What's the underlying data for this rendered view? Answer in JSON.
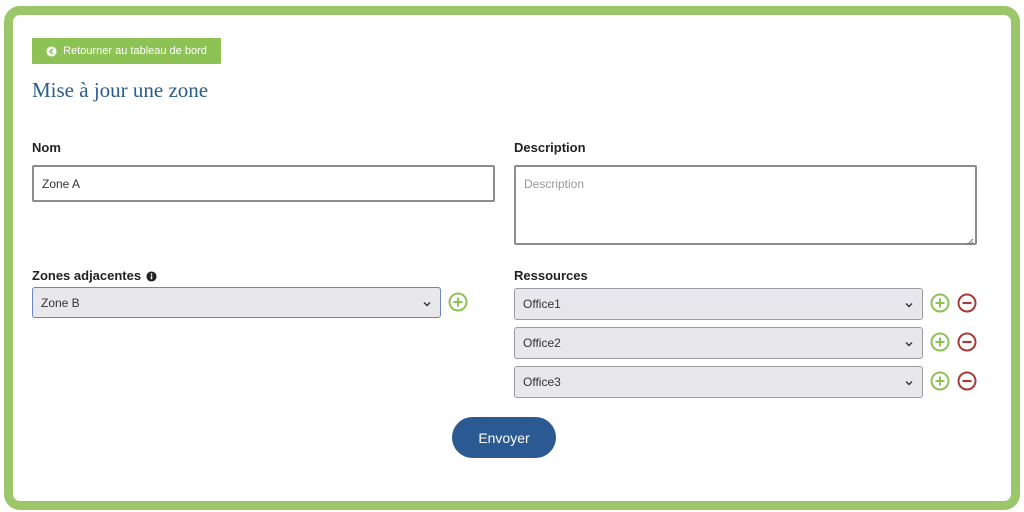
{
  "back_button": {
    "label": "Retourner au tableau de bord"
  },
  "page_title": "Mise à jour une zone",
  "nom": {
    "label": "Nom",
    "value": "Zone A"
  },
  "description": {
    "label": "Description",
    "placeholder": "Description",
    "value": ""
  },
  "zones_adjacentes": {
    "label": "Zones adjacentes",
    "selected": "Zone B"
  },
  "ressources": {
    "label": "Ressources",
    "items": [
      {
        "selected": "Office1"
      },
      {
        "selected": "Office2"
      },
      {
        "selected": "Office3"
      }
    ]
  },
  "submit_button": {
    "label": "Envoyer"
  },
  "colors": {
    "frame": "#9cc66a",
    "back_button_bg": "#8dc255",
    "title": "#2a5d8f",
    "add_icon": "#8dc255",
    "remove_icon": "#a83a3a",
    "submit_bg": "#2b5a92"
  },
  "icons": {
    "back": "arrow-left-circle-icon",
    "info": "info-circle-icon",
    "add": "plus-circle-icon",
    "remove": "minus-circle-icon",
    "dropdown": "chevron-down-icon"
  }
}
